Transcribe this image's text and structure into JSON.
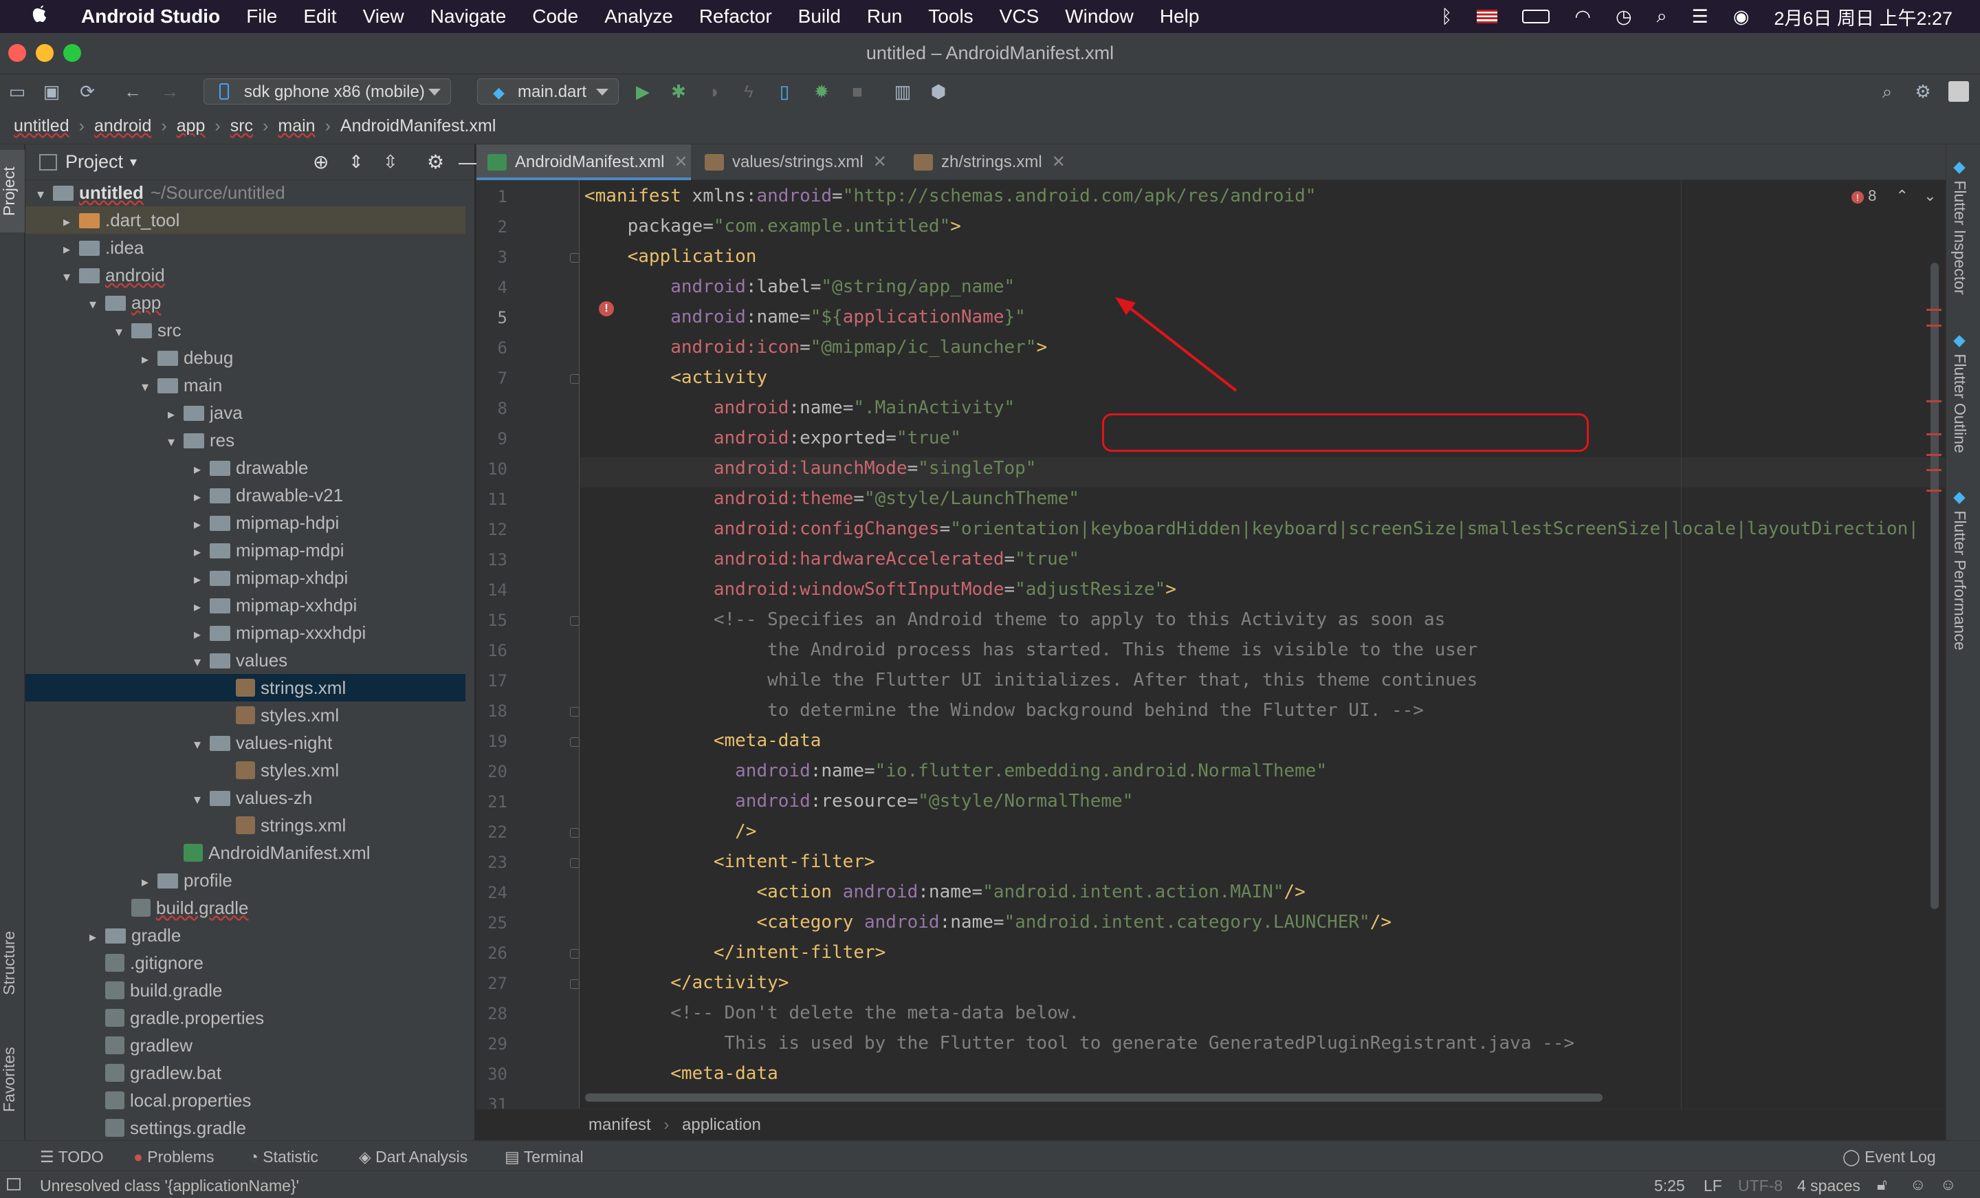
{
  "menubar": {
    "apple": "",
    "app": "Android Studio",
    "items": [
      "File",
      "Edit",
      "View",
      "Navigate",
      "Code",
      "Analyze",
      "Refactor",
      "Build",
      "Run",
      "Tools",
      "VCS",
      "Window",
      "Help"
    ],
    "datetime": "2月6日 周日 上午2:27"
  },
  "window": {
    "title": "untitled – AndroidManifest.xml"
  },
  "toolbar": {
    "device": "sdk gphone x86 (mobile)",
    "run_config": "main.dart"
  },
  "breadcrumb": [
    "untitled",
    "android",
    "app",
    "src",
    "main",
    "AndroidManifest.xml"
  ],
  "project": {
    "title": "Project",
    "tree": [
      {
        "label": "untitled",
        "extra": "~/Source/untitled",
        "depth": 0,
        "arrow": "▾",
        "kind": "mod"
      },
      {
        "label": ".dart_tool",
        "depth": 1,
        "arrow": "▸",
        "kind": "brown"
      },
      {
        "label": ".idea",
        "depth": 1,
        "arrow": "▸",
        "kind": "folder"
      },
      {
        "label": "android",
        "depth": 1,
        "arrow": "▾",
        "kind": "folder"
      },
      {
        "label": "app",
        "depth": 2,
        "arrow": "▾",
        "kind": "folder"
      },
      {
        "label": "src",
        "depth": 3,
        "arrow": "▾",
        "kind": "folder"
      },
      {
        "label": "debug",
        "depth": 4,
        "arrow": "▸",
        "kind": "folder"
      },
      {
        "label": "main",
        "depth": 4,
        "arrow": "▾",
        "kind": "folder"
      },
      {
        "label": "java",
        "depth": 5,
        "arrow": "▸",
        "kind": "folder"
      },
      {
        "label": "res",
        "depth": 5,
        "arrow": "▾",
        "kind": "folder"
      },
      {
        "label": "drawable",
        "depth": 6,
        "arrow": "▸",
        "kind": "folder"
      },
      {
        "label": "drawable-v21",
        "depth": 6,
        "arrow": "▸",
        "kind": "folder"
      },
      {
        "label": "mipmap-hdpi",
        "depth": 6,
        "arrow": "▸",
        "kind": "folder"
      },
      {
        "label": "mipmap-mdpi",
        "depth": 6,
        "arrow": "▸",
        "kind": "folder"
      },
      {
        "label": "mipmap-xhdpi",
        "depth": 6,
        "arrow": "▸",
        "kind": "folder"
      },
      {
        "label": "mipmap-xxhdpi",
        "depth": 6,
        "arrow": "▸",
        "kind": "folder"
      },
      {
        "label": "mipmap-xxxhdpi",
        "depth": 6,
        "arrow": "▸",
        "kind": "folder"
      },
      {
        "label": "values",
        "depth": 6,
        "arrow": "▾",
        "kind": "folder"
      },
      {
        "label": "strings.xml",
        "depth": 7,
        "arrow": "",
        "kind": "xml"
      },
      {
        "label": "styles.xml",
        "depth": 7,
        "arrow": "",
        "kind": "xml"
      },
      {
        "label": "values-night",
        "depth": 6,
        "arrow": "▾",
        "kind": "folder"
      },
      {
        "label": "styles.xml",
        "depth": 7,
        "arrow": "",
        "kind": "xml"
      },
      {
        "label": "values-zh",
        "depth": 6,
        "arrow": "▾",
        "kind": "folder"
      },
      {
        "label": "strings.xml",
        "depth": 7,
        "arrow": "",
        "kind": "xml"
      },
      {
        "label": "AndroidManifest.xml",
        "depth": 5,
        "arrow": "",
        "kind": "mf"
      },
      {
        "label": "profile",
        "depth": 4,
        "arrow": "▸",
        "kind": "folder"
      },
      {
        "label": "build.gradle",
        "depth": 3,
        "arrow": "",
        "kind": "gr"
      },
      {
        "label": "gradle",
        "depth": 2,
        "arrow": "▸",
        "kind": "folder"
      },
      {
        "label": ".gitignore",
        "depth": 2,
        "arrow": "",
        "kind": "gr"
      },
      {
        "label": "build.gradle",
        "depth": 2,
        "arrow": "",
        "kind": "gr"
      },
      {
        "label": "gradle.properties",
        "depth": 2,
        "arrow": "",
        "kind": "gr"
      },
      {
        "label": "gradlew",
        "depth": 2,
        "arrow": "",
        "kind": "gr"
      },
      {
        "label": "gradlew.bat",
        "depth": 2,
        "arrow": "",
        "kind": "gr"
      },
      {
        "label": "local.properties",
        "depth": 2,
        "arrow": "",
        "kind": "gr"
      },
      {
        "label": "settings.gradle",
        "depth": 2,
        "arrow": "",
        "kind": "gr"
      }
    ]
  },
  "tabs": [
    "AndroidManifest.xml",
    "values/strings.xml",
    "zh/strings.xml"
  ],
  "error_count": "8",
  "code_lines": [
    [
      [
        "t",
        "<manifest "
      ],
      [
        "a",
        "xmlns:"
      ],
      [
        "ns",
        "android"
      ],
      [
        "a",
        "="
      ],
      [
        "v",
        "\"http://schemas.android.com/apk/res/android\""
      ]
    ],
    [
      [
        "a",
        "    package"
      ],
      [
        "a",
        "="
      ],
      [
        "v",
        "\"com.example.untitled\""
      ],
      [
        "t",
        ">"
      ]
    ],
    [
      [
        "t",
        "    <application"
      ]
    ],
    [
      [
        "ns",
        "        android"
      ],
      [
        "a",
        ":label="
      ],
      [
        "v",
        "\"@string/app_name\""
      ]
    ],
    [
      [
        "ns",
        "        android"
      ],
      [
        "a",
        ":name="
      ],
      [
        "v",
        "\"${"
      ],
      [
        "red",
        "applicationName"
      ],
      [
        "v",
        "}\""
      ]
    ],
    [
      [
        "red",
        "        android:icon"
      ],
      [
        "a",
        "="
      ],
      [
        "v",
        "\"@mipmap/ic_launcher\""
      ],
      [
        "t",
        ">"
      ]
    ],
    [
      [
        "t",
        "        <activity"
      ]
    ],
    [
      [
        "red",
        "            android"
      ],
      [
        "a",
        ":name="
      ],
      [
        "v",
        "\".MainActivity\""
      ]
    ],
    [
      [
        "red",
        "            android"
      ],
      [
        "a",
        ":exported="
      ],
      [
        "v",
        "\"true\""
      ]
    ],
    [
      [
        "red",
        "            android:launchMode"
      ],
      [
        "a",
        "="
      ],
      [
        "v",
        "\"singleTop\""
      ]
    ],
    [
      [
        "red",
        "            android:theme"
      ],
      [
        "a",
        "="
      ],
      [
        "v",
        "\"@style/LaunchTheme\""
      ]
    ],
    [
      [
        "red",
        "            android:configChanges"
      ],
      [
        "a",
        "="
      ],
      [
        "v",
        "\"orientation|keyboardHidden|keyboard|screenSize|smallestScreenSize|locale|layoutDirection|"
      ]
    ],
    [
      [
        "red",
        "            android:hardwareAccelerated"
      ],
      [
        "a",
        "="
      ],
      [
        "v",
        "\"true\""
      ]
    ],
    [
      [
        "red",
        "            android:windowSoftInputMode"
      ],
      [
        "a",
        "="
      ],
      [
        "v",
        "\"adjustResize\""
      ],
      [
        "t",
        ">"
      ]
    ],
    [
      [
        "cm",
        "            <!-- Specifies an Android theme to apply to this Activity as soon as"
      ]
    ],
    [
      [
        "cm",
        "                 the Android process has started. This theme is visible to the user"
      ]
    ],
    [
      [
        "cm",
        "                 while the Flutter UI initializes. After that, this theme continues"
      ]
    ],
    [
      [
        "cm",
        "                 to determine the Window background behind the Flutter UI. -->"
      ]
    ],
    [
      [
        "t",
        "            <meta-data"
      ]
    ],
    [
      [
        "ns",
        "              android"
      ],
      [
        "a",
        ":name="
      ],
      [
        "v",
        "\"io.flutter.embedding.android.NormalTheme\""
      ]
    ],
    [
      [
        "ns",
        "              android"
      ],
      [
        "a",
        ":resource="
      ],
      [
        "v",
        "\"@style/NormalTheme\""
      ]
    ],
    [
      [
        "t",
        "              />"
      ]
    ],
    [
      [
        "t",
        "            <intent-filter>"
      ]
    ],
    [
      [
        "t",
        "                <action "
      ],
      [
        "ns",
        "android"
      ],
      [
        "a",
        ":name="
      ],
      [
        "v",
        "\"android.intent.action.MAIN\""
      ],
      [
        "t",
        "/>"
      ]
    ],
    [
      [
        "t",
        "                <category "
      ],
      [
        "ns",
        "android"
      ],
      [
        "a",
        ":name="
      ],
      [
        "v",
        "\"android.intent.category.LAUNCHER\""
      ],
      [
        "t",
        "/>"
      ]
    ],
    [
      [
        "t",
        "            </intent-filter>"
      ]
    ],
    [
      [
        "t",
        "        </activity>"
      ]
    ],
    [
      [
        "cm",
        "        <!-- Don't delete the meta-data below."
      ]
    ],
    [
      [
        "cm",
        "             This is used by the Flutter tool to generate GeneratedPluginRegistrant.java -->"
      ]
    ],
    [
      [
        "t",
        "        <meta-data"
      ]
    ],
    [
      [
        "a",
        ""
      ]
    ]
  ],
  "editor_breadcrumb": [
    "manifest",
    "application"
  ],
  "right_tools": [
    "Flutter Inspector",
    "Flutter Outline",
    "Flutter Performance"
  ],
  "left_tools": [
    "Project",
    "Structure",
    "Favorites"
  ],
  "bottom_tools": [
    "TODO",
    "Problems",
    "Statistic",
    "Dart Analysis",
    "Terminal"
  ],
  "event_log": "Event Log",
  "status": {
    "message": "Unresolved class '{applicationName}'",
    "position": "5:25",
    "line_sep": "LF",
    "encoding": "UTF-8",
    "indent": "4 spaces"
  }
}
